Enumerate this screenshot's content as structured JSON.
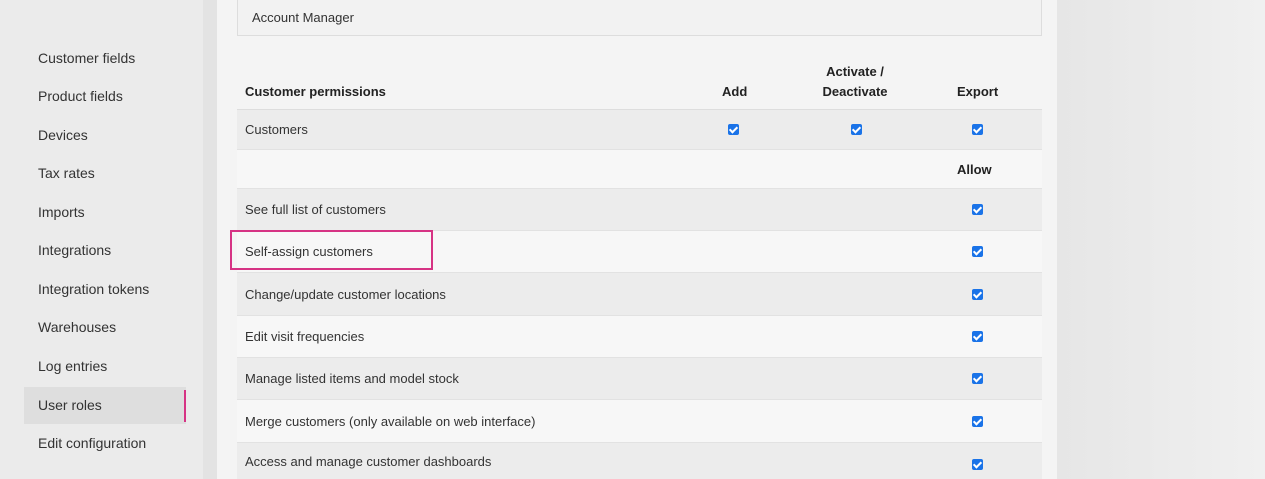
{
  "sidebar": {
    "items": [
      {
        "label": "Customer fields"
      },
      {
        "label": "Product fields"
      },
      {
        "label": "Devices"
      },
      {
        "label": "Tax rates"
      },
      {
        "label": "Imports"
      },
      {
        "label": "Integrations"
      },
      {
        "label": "Integration tokens"
      },
      {
        "label": "Warehouses"
      },
      {
        "label": "Log entries"
      },
      {
        "label": "User roles",
        "active": true
      },
      {
        "label": "Edit configuration"
      }
    ],
    "active_color": "#d63384"
  },
  "section_header": "Account Manager",
  "table": {
    "col_permissions": "Customer permissions",
    "col_add": "Add",
    "col_activate_line1": "Activate /",
    "col_activate_line2": "Deactivate",
    "col_export": "Export",
    "customers_row": {
      "label": "Customers",
      "add": true,
      "activate": true,
      "export": true
    },
    "allow_header": "Allow",
    "allow_rows": [
      {
        "label": "See full list of customers",
        "allow": true
      },
      {
        "label": "Self-assign customers",
        "allow": true,
        "highlighted": true
      },
      {
        "label": "Change/update customer locations",
        "allow": true
      },
      {
        "label": "Edit visit frequencies",
        "allow": true
      },
      {
        "label": "Manage listed items and model stock",
        "allow": true
      },
      {
        "label": "Merge customers (only available on web interface)",
        "allow": true
      },
      {
        "label": "Access and manage customer dashboards",
        "allow": true
      }
    ]
  },
  "colors": {
    "checkbox": "#1a73e8",
    "highlight": "#d63384"
  }
}
